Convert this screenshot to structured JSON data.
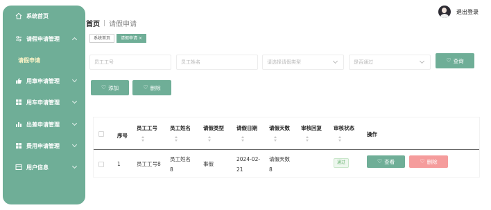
{
  "sidebar": {
    "items": [
      {
        "label": "系统首页",
        "icon": "home-icon",
        "expandable": false
      },
      {
        "label": "请假申请管理",
        "icon": "sliders-icon",
        "expandable": true,
        "expanded": true
      },
      {
        "label": "用章申请管理",
        "icon": "thumbs-up-icon",
        "expandable": true
      },
      {
        "label": "用车申请管理",
        "icon": "grid-icon",
        "expandable": true
      },
      {
        "label": "出差申请管理",
        "icon": "bar-chart-icon",
        "expandable": true
      },
      {
        "label": "费用申请管理",
        "icon": "grid-icon",
        "expandable": true
      },
      {
        "label": "用户信息",
        "icon": "window-icon",
        "expandable": true
      }
    ],
    "sub_item": "请假申请"
  },
  "header": {
    "home": "首页",
    "separator": "|",
    "current": "请假申请",
    "logout": "退出登录"
  },
  "tabs": [
    {
      "label": "系统首页",
      "active": false
    },
    {
      "label": "请假申请",
      "active": true,
      "close": "×"
    }
  ],
  "search": {
    "employee_id_placeholder": "员工工号",
    "employee_name_placeholder": "员工姓名",
    "leave_type_placeholder": "请选择请假类型",
    "approved_placeholder": "是否通过",
    "query_label": "查询"
  },
  "actions": {
    "add_label": "添加",
    "delete_label": "删除"
  },
  "table": {
    "columns": [
      "序号",
      "员工工号",
      "员工姓名",
      "请假类型",
      "请假日期",
      "请假天数",
      "审核回复",
      "审核状态",
      "操作"
    ],
    "rows": [
      {
        "index": "1",
        "employee_id": "员工工号8",
        "employee_name_1": "员工姓名",
        "employee_name_2": "8",
        "leave_type": "事假",
        "date_1": "2024-02-",
        "date_2": "21",
        "days_1": "请假天数",
        "days_2": "8",
        "reply": "",
        "status": "通过",
        "view_label": "查看",
        "delete_label": "删除"
      }
    ]
  },
  "colors": {
    "accent": "#6fae97",
    "danger": "#f59c9c",
    "badge_text": "#67b26f"
  }
}
